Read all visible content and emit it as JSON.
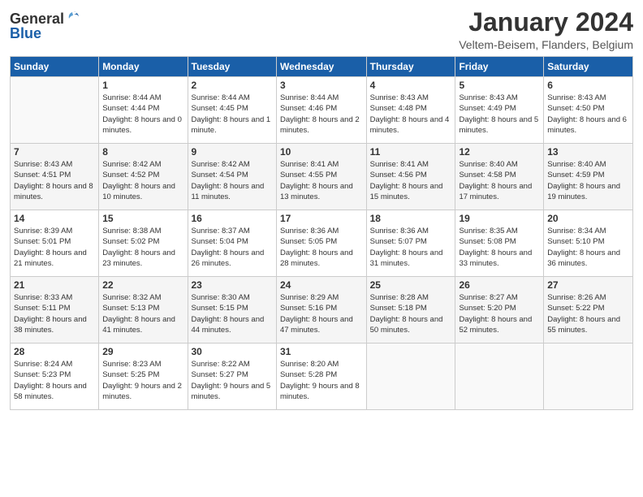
{
  "header": {
    "logo_general": "General",
    "logo_blue": "Blue",
    "month_year": "January 2024",
    "location": "Veltem-Beisem, Flanders, Belgium"
  },
  "days_of_week": [
    "Sunday",
    "Monday",
    "Tuesday",
    "Wednesday",
    "Thursday",
    "Friday",
    "Saturday"
  ],
  "weeks": [
    [
      {
        "day": "",
        "sunrise": "",
        "sunset": "",
        "daylight": ""
      },
      {
        "day": "1",
        "sunrise": "Sunrise: 8:44 AM",
        "sunset": "Sunset: 4:44 PM",
        "daylight": "Daylight: 8 hours and 0 minutes."
      },
      {
        "day": "2",
        "sunrise": "Sunrise: 8:44 AM",
        "sunset": "Sunset: 4:45 PM",
        "daylight": "Daylight: 8 hours and 1 minute."
      },
      {
        "day": "3",
        "sunrise": "Sunrise: 8:44 AM",
        "sunset": "Sunset: 4:46 PM",
        "daylight": "Daylight: 8 hours and 2 minutes."
      },
      {
        "day": "4",
        "sunrise": "Sunrise: 8:43 AM",
        "sunset": "Sunset: 4:48 PM",
        "daylight": "Daylight: 8 hours and 4 minutes."
      },
      {
        "day": "5",
        "sunrise": "Sunrise: 8:43 AM",
        "sunset": "Sunset: 4:49 PM",
        "daylight": "Daylight: 8 hours and 5 minutes."
      },
      {
        "day": "6",
        "sunrise": "Sunrise: 8:43 AM",
        "sunset": "Sunset: 4:50 PM",
        "daylight": "Daylight: 8 hours and 6 minutes."
      }
    ],
    [
      {
        "day": "7",
        "sunrise": "Sunrise: 8:43 AM",
        "sunset": "Sunset: 4:51 PM",
        "daylight": "Daylight: 8 hours and 8 minutes."
      },
      {
        "day": "8",
        "sunrise": "Sunrise: 8:42 AM",
        "sunset": "Sunset: 4:52 PM",
        "daylight": "Daylight: 8 hours and 10 minutes."
      },
      {
        "day": "9",
        "sunrise": "Sunrise: 8:42 AM",
        "sunset": "Sunset: 4:54 PM",
        "daylight": "Daylight: 8 hours and 11 minutes."
      },
      {
        "day": "10",
        "sunrise": "Sunrise: 8:41 AM",
        "sunset": "Sunset: 4:55 PM",
        "daylight": "Daylight: 8 hours and 13 minutes."
      },
      {
        "day": "11",
        "sunrise": "Sunrise: 8:41 AM",
        "sunset": "Sunset: 4:56 PM",
        "daylight": "Daylight: 8 hours and 15 minutes."
      },
      {
        "day": "12",
        "sunrise": "Sunrise: 8:40 AM",
        "sunset": "Sunset: 4:58 PM",
        "daylight": "Daylight: 8 hours and 17 minutes."
      },
      {
        "day": "13",
        "sunrise": "Sunrise: 8:40 AM",
        "sunset": "Sunset: 4:59 PM",
        "daylight": "Daylight: 8 hours and 19 minutes."
      }
    ],
    [
      {
        "day": "14",
        "sunrise": "Sunrise: 8:39 AM",
        "sunset": "Sunset: 5:01 PM",
        "daylight": "Daylight: 8 hours and 21 minutes."
      },
      {
        "day": "15",
        "sunrise": "Sunrise: 8:38 AM",
        "sunset": "Sunset: 5:02 PM",
        "daylight": "Daylight: 8 hours and 23 minutes."
      },
      {
        "day": "16",
        "sunrise": "Sunrise: 8:37 AM",
        "sunset": "Sunset: 5:04 PM",
        "daylight": "Daylight: 8 hours and 26 minutes."
      },
      {
        "day": "17",
        "sunrise": "Sunrise: 8:36 AM",
        "sunset": "Sunset: 5:05 PM",
        "daylight": "Daylight: 8 hours and 28 minutes."
      },
      {
        "day": "18",
        "sunrise": "Sunrise: 8:36 AM",
        "sunset": "Sunset: 5:07 PM",
        "daylight": "Daylight: 8 hours and 31 minutes."
      },
      {
        "day": "19",
        "sunrise": "Sunrise: 8:35 AM",
        "sunset": "Sunset: 5:08 PM",
        "daylight": "Daylight: 8 hours and 33 minutes."
      },
      {
        "day": "20",
        "sunrise": "Sunrise: 8:34 AM",
        "sunset": "Sunset: 5:10 PM",
        "daylight": "Daylight: 8 hours and 36 minutes."
      }
    ],
    [
      {
        "day": "21",
        "sunrise": "Sunrise: 8:33 AM",
        "sunset": "Sunset: 5:11 PM",
        "daylight": "Daylight: 8 hours and 38 minutes."
      },
      {
        "day": "22",
        "sunrise": "Sunrise: 8:32 AM",
        "sunset": "Sunset: 5:13 PM",
        "daylight": "Daylight: 8 hours and 41 minutes."
      },
      {
        "day": "23",
        "sunrise": "Sunrise: 8:30 AM",
        "sunset": "Sunset: 5:15 PM",
        "daylight": "Daylight: 8 hours and 44 minutes."
      },
      {
        "day": "24",
        "sunrise": "Sunrise: 8:29 AM",
        "sunset": "Sunset: 5:16 PM",
        "daylight": "Daylight: 8 hours and 47 minutes."
      },
      {
        "day": "25",
        "sunrise": "Sunrise: 8:28 AM",
        "sunset": "Sunset: 5:18 PM",
        "daylight": "Daylight: 8 hours and 50 minutes."
      },
      {
        "day": "26",
        "sunrise": "Sunrise: 8:27 AM",
        "sunset": "Sunset: 5:20 PM",
        "daylight": "Daylight: 8 hours and 52 minutes."
      },
      {
        "day": "27",
        "sunrise": "Sunrise: 8:26 AM",
        "sunset": "Sunset: 5:22 PM",
        "daylight": "Daylight: 8 hours and 55 minutes."
      }
    ],
    [
      {
        "day": "28",
        "sunrise": "Sunrise: 8:24 AM",
        "sunset": "Sunset: 5:23 PM",
        "daylight": "Daylight: 8 hours and 58 minutes."
      },
      {
        "day": "29",
        "sunrise": "Sunrise: 8:23 AM",
        "sunset": "Sunset: 5:25 PM",
        "daylight": "Daylight: 9 hours and 2 minutes."
      },
      {
        "day": "30",
        "sunrise": "Sunrise: 8:22 AM",
        "sunset": "Sunset: 5:27 PM",
        "daylight": "Daylight: 9 hours and 5 minutes."
      },
      {
        "day": "31",
        "sunrise": "Sunrise: 8:20 AM",
        "sunset": "Sunset: 5:28 PM",
        "daylight": "Daylight: 9 hours and 8 minutes."
      },
      {
        "day": "",
        "sunrise": "",
        "sunset": "",
        "daylight": ""
      },
      {
        "day": "",
        "sunrise": "",
        "sunset": "",
        "daylight": ""
      },
      {
        "day": "",
        "sunrise": "",
        "sunset": "",
        "daylight": ""
      }
    ]
  ]
}
